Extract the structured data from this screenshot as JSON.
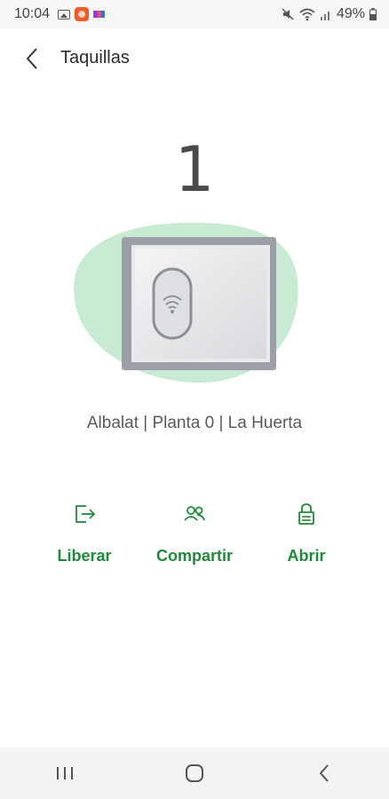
{
  "status_bar": {
    "time": "10:04",
    "battery": "49%",
    "icons": [
      "gallery-icon",
      "app-notification-icon",
      "bars-icon",
      "mute-icon",
      "wifi-icon",
      "signal-icon",
      "battery-icon"
    ]
  },
  "header": {
    "back_icon": "chevron-left-icon",
    "title": "Taquillas"
  },
  "locker": {
    "number": "1",
    "location": "Albalat | Planta 0 | La Huerta",
    "illustration": "locker-with-nfc-icon",
    "accent_color": "#c9ebd3"
  },
  "actions": [
    {
      "label": "Liberar",
      "icon": "exit-icon"
    },
    {
      "label": "Compartir",
      "icon": "users-icon"
    },
    {
      "label": "Abrir",
      "icon": "lock-icon"
    }
  ],
  "colors": {
    "action_green": "#1f8a3a",
    "blob_green": "#c9ebd3"
  },
  "nav_bar": {
    "buttons": [
      "recent-apps-icon",
      "home-icon",
      "back-icon"
    ]
  }
}
